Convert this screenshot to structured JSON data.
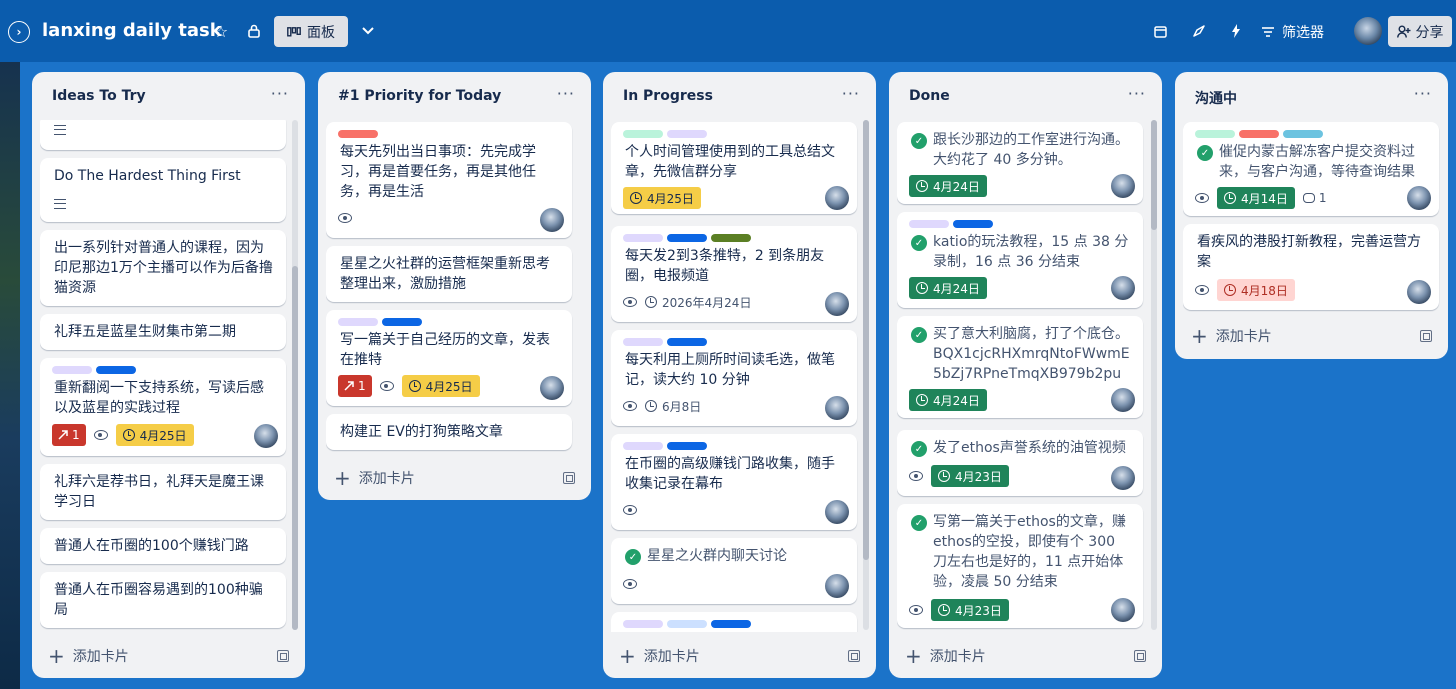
{
  "header": {
    "title": "lanxing daily task",
    "view_label": "面板",
    "filter_label": "筛选器",
    "share_label": "分享"
  },
  "colors": {
    "header_bg": "#0b5cad",
    "board_bg": "#1b73c9",
    "list_bg": "#f1f2f4",
    "due_yellow": "#f5cd47",
    "due_green": "#1f845a",
    "due_red_bg": "#ffd5d2",
    "priority_red": "#c9372c"
  },
  "lists": [
    {
      "title": "Ideas To Try",
      "add_label": "添加卡片",
      "cards": [
        {
          "text": ""
        },
        {
          "text": "Do The Hardest Thing First"
        },
        {
          "text": "出一系列针对普通人的课程，因为印尼那边1万个主播可以作为后备撸猫资源"
        },
        {
          "text": "礼拜五是蓝星生财集市第二期"
        },
        {
          "text": "重新翻阅一下支持系统，写读后感以及蓝星的实践过程",
          "priority": "1",
          "due": "4月25日"
        },
        {
          "text": "礼拜六是荐书日，礼拜天是魔王课学习日"
        },
        {
          "text": "普通人在币圈的100个赚钱门路"
        },
        {
          "text": "普通人在币圈容易遇到的100种骗局"
        }
      ]
    },
    {
      "title": "#1 Priority for Today",
      "add_label": "添加卡片",
      "cards": [
        {
          "text": "每天先列出当日事项：先完成学习，再是首要任务，再是其他任务，再是生活"
        },
        {
          "text": "星星之火社群的运营框架重新思考整理出来，激励措施"
        },
        {
          "text": "写一篇关于自己经历的文章，发表在推特",
          "priority": "1",
          "due": "4月25日"
        },
        {
          "text": "构建正 EV的打狗策略文章"
        }
      ]
    },
    {
      "title": "In Progress",
      "add_label": "添加卡片",
      "cards": [
        {
          "text": "个人时间管理使用到的工具总结文章，先微信群分享",
          "due": "4月25日"
        },
        {
          "text": "每天发2到3条推特，2 到条朋友圈，电报频道",
          "due": "2026年4月24日"
        },
        {
          "text": "每天利用上厕所时间读毛选，做笔记，读大约 10 分钟",
          "due": "6月8日"
        },
        {
          "text": "在币圈的高级赚钱门路收集，随手收集记录在幕布"
        },
        {
          "text": "星星之火群内聊天讨论"
        }
      ]
    },
    {
      "title": "Done",
      "add_label": "添加卡片",
      "cards": [
        {
          "text": "跟长沙那边的工作室进行沟通。大约花了 40 多分钟。",
          "due": "4月24日"
        },
        {
          "text": "katio的玩法教程，15 点 38 分录制，16 点 36 分结束",
          "due": "4月24日"
        },
        {
          "text": "买了意大利脑腐，打了个底仓。BQX1cjcRHXmrqNtoFWwmE5bZj7RPneTmqXB979b2pump",
          "due": "4月24日"
        },
        {
          "text": "发了ethos声誉系统的油管视频",
          "due": "4月23日"
        },
        {
          "text": "写第一篇关于ethos的文章，赚ethos的空投，即使有个 300 刀左右也是好的，11 点开始体验，凌晨 50 分结束",
          "due": "4月23日"
        }
      ]
    },
    {
      "title": "沟通中",
      "add_label": "添加卡片",
      "cards": [
        {
          "text": "催促内蒙古解冻客户提交资料过来，与客户沟通，等待查询结果",
          "due": "4月14日",
          "comments": "1"
        },
        {
          "text": "看疾风的港股打新教程，完善运营方案",
          "due": "4月18日"
        }
      ]
    }
  ]
}
